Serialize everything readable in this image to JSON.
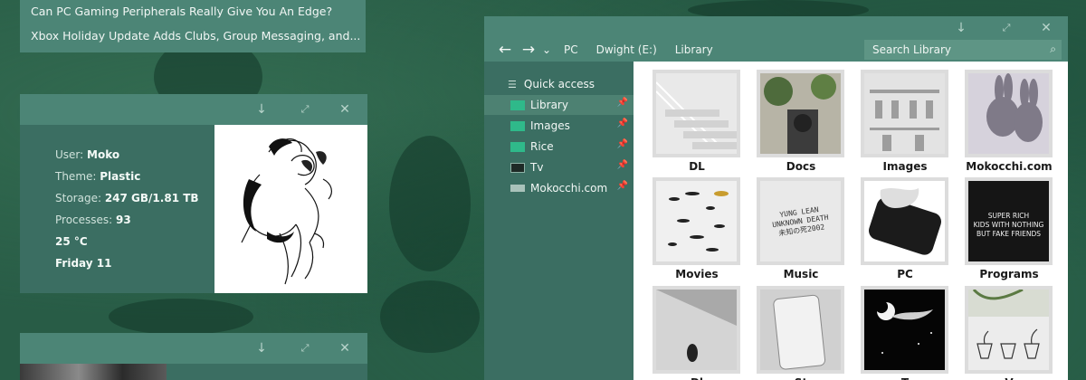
{
  "news": {
    "items": [
      "Can PC Gaming Peripherals Really Give You An Edge?",
      "Xbox Holiday Update Adds Clubs, Group Messaging, and..."
    ]
  },
  "info_panel": {
    "rows": [
      {
        "key": "User:",
        "value": "Moko"
      },
      {
        "key": "Theme:",
        "value": "Plastic"
      },
      {
        "key": "Storage:",
        "value": "247 GB/1.81 TB"
      },
      {
        "key": "Processes:",
        "value": "93"
      },
      {
        "key": "",
        "value": "25 °C"
      },
      {
        "key": "",
        "value": "Friday 11"
      }
    ]
  },
  "window_controls": {
    "minimize": "↓",
    "restore": "⤢",
    "close": "✕"
  },
  "explorer": {
    "back": "←",
    "forward": "→",
    "dropdown": "⌄",
    "breadcrumb": [
      "PC",
      "Dwight (E:)",
      "Library"
    ],
    "search_placeholder": "Search Library",
    "sidebar": [
      {
        "label": "Quick access",
        "icon": "menu-icon",
        "pinned": false,
        "active": false
      },
      {
        "label": "Library",
        "icon": "folder-icon",
        "pinned": true,
        "active": true
      },
      {
        "label": "Images",
        "icon": "folder-icon",
        "pinned": true,
        "active": false
      },
      {
        "label": "Rice",
        "icon": "folder-icon",
        "pinned": true,
        "active": false
      },
      {
        "label": "Tv",
        "icon": "film-icon",
        "pinned": true,
        "active": false
      },
      {
        "label": "Mokocchi.com",
        "icon": "drive-icon",
        "pinned": true,
        "active": false
      }
    ],
    "folders": [
      {
        "label": "DL",
        "thumb_text": ""
      },
      {
        "label": "Docs",
        "thumb_text": ""
      },
      {
        "label": "Images",
        "thumb_text": ""
      },
      {
        "label": "Mokocchi.com",
        "thumb_text": ""
      },
      {
        "label": "Movies",
        "thumb_text": ""
      },
      {
        "label": "Music",
        "thumb_text": "YUNG LEAN\nUNKNOWN DEATH\n未知の死2002"
      },
      {
        "label": "PC",
        "thumb_text": ""
      },
      {
        "label": "Programs",
        "thumb_text": "SUPER RICH\nKIDS WITH NOTHING\nBUT FAKE FRIENDS"
      },
      {
        "label": "Dl",
        "thumb_text": ""
      },
      {
        "label": "St",
        "thumb_text": ""
      },
      {
        "label": "T",
        "thumb_text": ""
      },
      {
        "label": "V",
        "thumb_text": ""
      }
    ]
  },
  "colors": {
    "panel": "#3b6e62",
    "titlebar": "#4c8576",
    "accent_folder": "#2fb98a",
    "desktop": "#285c46"
  }
}
